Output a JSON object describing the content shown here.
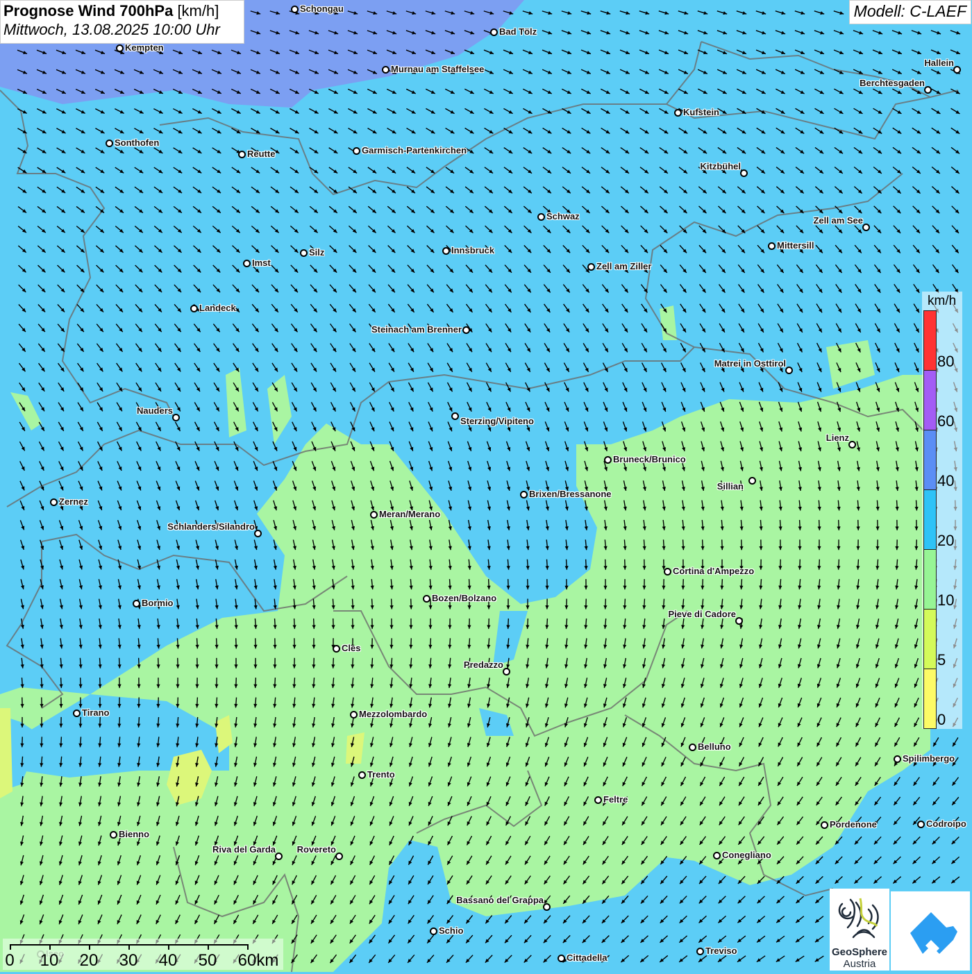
{
  "header": {
    "title_bold": "Prognose Wind 700hPa",
    "title_unit": "[km/h]",
    "datetime": "Mittwoch, 13.08.2025 10:00 Uhr",
    "model": "Modell: C-LAEF"
  },
  "legend": {
    "unit": "km/h",
    "ticks": [
      "80",
      "60",
      "40",
      "20",
      "10",
      "5",
      "0"
    ],
    "colors": [
      "#ff3333",
      "#a35cf5",
      "#5b8ef5",
      "#2ec3f7",
      "#97f595",
      "#d4fa5a",
      "#fdfb66"
    ]
  },
  "scale_bar": {
    "labels": [
      "0",
      "10",
      "20",
      "30",
      "40",
      "50",
      "60km"
    ]
  },
  "logos": {
    "geosphere": "GeoSphere",
    "geosphere_sub": "Austria"
  },
  "colors": {
    "blue_20_40": "#5ccdf6",
    "blue_40_60": "#7c9ff2",
    "green_10_20": "#a9f5a2",
    "yellow_5_10": "#dcf77a"
  },
  "cities": [
    "Schongau",
    "Bad Tölz",
    "Kempten",
    "Murnau am Staffelsee",
    "Hallein",
    "Berchtesgaden",
    "Kufstein",
    "Sonthofen",
    "Reutte",
    "Garmisch-Partenkirchen",
    "Kitzbühel",
    "Schwaz",
    "Zell am See",
    "Innsbruck",
    "Silz",
    "Mittersill",
    "Imst",
    "Zell am Ziller",
    "Landeck",
    "Steinach am Brenner",
    "Matrei in Osttirol",
    "Nauders",
    "Sterzing/Vipiteno",
    "Lienz",
    "Bruneck/Brunico",
    "Sillian",
    "Brixen/Bressanone",
    "Zernez",
    "Meran/Merano",
    "Schlanders/Silandro",
    "Cortina d'Ampezzo",
    "Bozen/Bolzano",
    "Bormio",
    "Pieve di Cadore",
    "Cles",
    "Predazzo",
    "Tirano",
    "Mezzolombardo",
    "Belluno",
    "Spilimbergo",
    "Trento",
    "Feltre",
    "Pordenone",
    "Codroipo",
    "Bienno",
    "Riva del Garda",
    "Rovereto",
    "Conegliano",
    "Bassano del Grappa",
    "Schio",
    "Treviso",
    "Cittadella",
    "Iseo"
  ]
}
